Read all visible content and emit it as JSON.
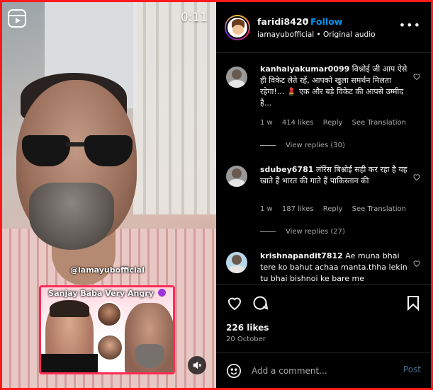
{
  "video": {
    "timer": "0:11",
    "watermark": "@iamayubofficial",
    "thumbnail_title": "Sanjay Baba Very Angry",
    "icons": {
      "reels": "reels-icon",
      "mute": "speaker-muted-icon"
    }
  },
  "header": {
    "username": "faridi8420",
    "separator": "•",
    "follow_label": "Follow",
    "subtitle": "iamayubofficial • Original audio",
    "more_label": "•••"
  },
  "comments": [
    {
      "username": "kanhaiyakumar0099",
      "text": "विश्नोई जी आप ऐसे ही विकेट लेते रहें, आपको खुला समर्थन मिलता रहेगा!... 💄 एक और बड़े विकेट की आपसे उम्मीद है...",
      "time": "1 w",
      "likes": "414 likes",
      "reply_label": "Reply",
      "translate_label": "See Translation",
      "view_replies": "View replies (30)"
    },
    {
      "username": "sdubey6781",
      "text": "लॉरेंस बिश्नोई सही कर रहा है यह खाते हैं भारत की गाते हैं पाकिस्तान की",
      "time": "1 w",
      "likes": "187 likes",
      "reply_label": "Reply",
      "translate_label": "See Translation",
      "view_replies": "View replies (27)"
    },
    {
      "username": "krishnapandit7812",
      "text": "Ae muna bhai tere ko bahut achaa manta.thha lekin tu bhai bishnoi ke bare me"
    }
  ],
  "actions": {
    "likes": "226 likes",
    "date": "20 October"
  },
  "add_comment": {
    "placeholder": "Add a comment...",
    "post_label": "Post"
  },
  "colors": {
    "outer_border": "#ff1a1a",
    "background": "#000000",
    "link_blue": "#0095f6",
    "muted_text": "#a8a8a8"
  }
}
